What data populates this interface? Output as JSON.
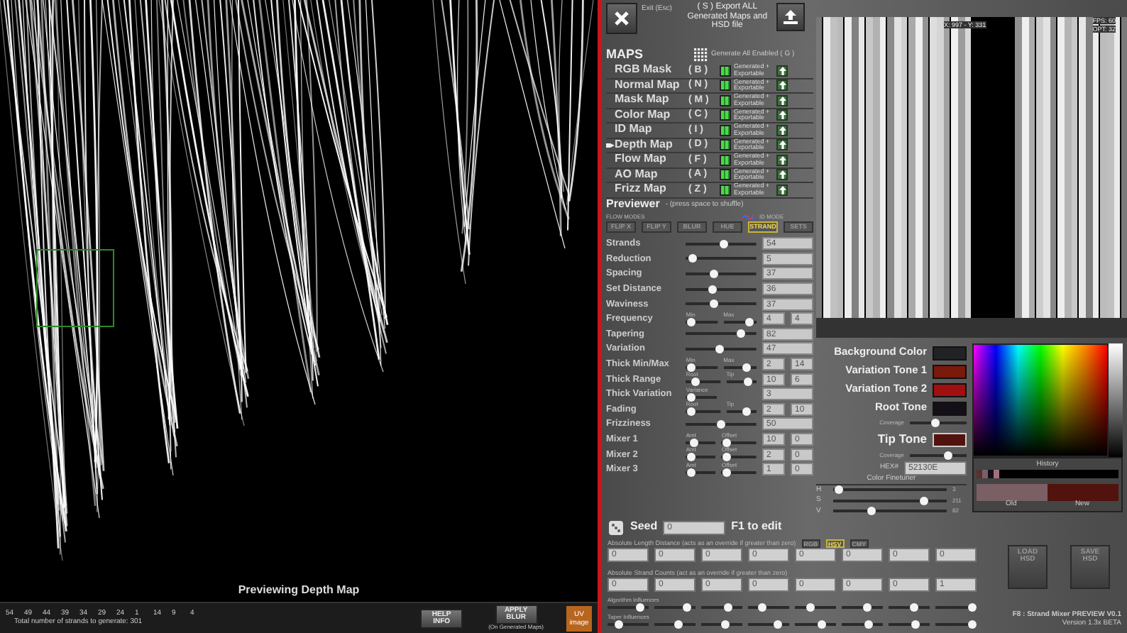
{
  "canvas": {
    "caption": "Previewing Depth Map"
  },
  "status_bar": {
    "counts": [
      "54",
      "49",
      "44",
      "39",
      "34",
      "29",
      "24",
      "1",
      "14",
      "9",
      "4"
    ],
    "total": "Total number of strands to generate: 301",
    "help_button": "HELP INFO",
    "blur_button": "APPLY BLUR",
    "blur_note": "(On Generated Maps)",
    "uv_button": "UV image"
  },
  "header": {
    "exit_label": "Exit (Esc)",
    "export_label": "( S ) Export ALL Generated Maps and HSD file"
  },
  "maps": {
    "title": "MAPS",
    "generate_all": "Generate All Enabled ( G )",
    "items": [
      {
        "name": "RGB Mask",
        "key": "( B )",
        "checked": true,
        "status": "Generated + Exportable",
        "previewing": false
      },
      {
        "name": "Normal Map",
        "key": "( N )",
        "checked": true,
        "status": "Generated + Exportable",
        "previewing": false
      },
      {
        "name": "Mask Map",
        "key": "( M )",
        "checked": true,
        "status": "Generated + Exportable",
        "previewing": false
      },
      {
        "name": "Color Map",
        "key": "( C )",
        "checked": true,
        "status": "Generated + Exportable",
        "previewing": false
      },
      {
        "name": "ID Map",
        "key": "( I )",
        "checked": true,
        "status": "Generated + Exportable",
        "previewing": false
      },
      {
        "name": "Depth Map",
        "key": "( D )",
        "checked": true,
        "status": "Generated + Exportable",
        "previewing": true
      },
      {
        "name": "Flow Map",
        "key": "( F )",
        "checked": true,
        "status": "Generated + Exportable",
        "previewing": false
      },
      {
        "name": "AO Map",
        "key": "( A )",
        "checked": true,
        "status": "Generated + Exportable",
        "previewing": false
      },
      {
        "name": "Frizz Map",
        "key": "( Z )",
        "checked": true,
        "status": "Generated + Exportable",
        "previewing": false
      }
    ]
  },
  "previewer": {
    "label": "Previewer",
    "hint": "- (press space to shuffle)",
    "flow_modes_label": "FLOW MODES",
    "id_mode_label": "ID MODE",
    "modes": [
      {
        "label": "FLIP X",
        "selected": false
      },
      {
        "label": "FLIP Y",
        "selected": false
      },
      {
        "label": "BLUR",
        "selected": false
      },
      {
        "label": "HUE",
        "selected": false
      },
      {
        "label": "STRAND",
        "selected": true
      },
      {
        "label": "SETS",
        "selected": false
      }
    ]
  },
  "sliders": [
    {
      "label": "Strands",
      "kind": "single",
      "level": 0.55,
      "value": "54"
    },
    {
      "label": "Reduction",
      "kind": "single",
      "level": 0.04,
      "value": "5"
    },
    {
      "label": "Spacing",
      "kind": "single",
      "level": 0.38,
      "value": "37"
    },
    {
      "label": "Set Distance",
      "kind": "single",
      "level": 0.36,
      "value": "36"
    },
    {
      "label": "Waviness",
      "kind": "single",
      "level": 0.38,
      "value": "37"
    },
    {
      "label": "Frequency",
      "kind": "dual",
      "parts": [
        {
          "caption": "Min",
          "level": 0.05,
          "value": "4"
        },
        {
          "caption": "Max",
          "level": 0.9,
          "value": "4"
        }
      ]
    },
    {
      "label": "Tapering",
      "kind": "single",
      "level": 0.82,
      "value": "82"
    },
    {
      "label": "Variation",
      "kind": "single",
      "level": 0.47,
      "value": "47"
    },
    {
      "label": "Thick Min/Max",
      "kind": "dual",
      "parts": [
        {
          "caption": "Min",
          "level": 0.05,
          "value": "2"
        },
        {
          "caption": "Max",
          "level": 0.75,
          "value": "14"
        }
      ]
    },
    {
      "label": "Thick Range",
      "kind": "dual",
      "parts": [
        {
          "caption": "Root",
          "level": 0.2,
          "value": "10"
        },
        {
          "caption": "Tip",
          "level": 0.8,
          "value": "6"
        }
      ]
    },
    {
      "label": "Thick Variation",
      "kind": "captioned",
      "caption": "Variance",
      "level": 0.03,
      "value": "3"
    },
    {
      "label": "Fading",
      "kind": "dual",
      "parts": [
        {
          "caption": "Root",
          "level": 0.05,
          "value": "2"
        },
        {
          "caption": "Tip",
          "level": 0.75,
          "value": "10"
        }
      ]
    },
    {
      "label": "Frizziness",
      "kind": "single",
      "level": 0.5,
      "value": "50"
    },
    {
      "label": "Mixer 1",
      "kind": "dual",
      "parts": [
        {
          "caption": "Amt",
          "level": 0.2,
          "value": "10"
        },
        {
          "caption": "Offset",
          "level": 0.05,
          "value": "0"
        }
      ]
    },
    {
      "label": "Mixer 2",
      "kind": "dual",
      "parts": [
        {
          "caption": "Amt",
          "level": 0.05,
          "value": "2"
        },
        {
          "caption": "Offset",
          "level": 0.05,
          "value": "0"
        }
      ]
    },
    {
      "label": "Mixer 3",
      "kind": "dual",
      "parts": [
        {
          "caption": "Amt",
          "level": 0.05,
          "value": "1"
        },
        {
          "caption": "Offset",
          "level": 0.05,
          "value": "0"
        }
      ]
    }
  ],
  "preview": {
    "coords": "X: 997 - Y: 331",
    "fps": "FPS: 60",
    "opt": "OPT: 32"
  },
  "colors": {
    "swatches": [
      {
        "label": "Background Color",
        "color": "#202226",
        "selected": false
      },
      {
        "label": "Variation Tone 1",
        "color": "#7a1a0a",
        "selected": false
      },
      {
        "label": "Variation Tone 2",
        "color": "#a01010",
        "selected": false
      },
      {
        "label": "Root Tone",
        "color": "#151018",
        "selected": false,
        "coverage": {
          "label": "Coverage",
          "level": 0.45
        }
      },
      {
        "label": "Tip Tone",
        "color": "#52130e",
        "selected": true,
        "coverage": {
          "label": "Coverage",
          "level": 0.7
        }
      }
    ],
    "hex": {
      "label": "HEX#",
      "value": "52130E"
    },
    "finetuner_label": "Color Finetuner",
    "hsv": [
      {
        "label": "H",
        "level": 0.02,
        "value": "3"
      },
      {
        "label": "S",
        "level": 0.83,
        "value": "211"
      },
      {
        "label": "V",
        "level": 0.32,
        "value": "82"
      }
    ],
    "modes": [
      {
        "label": "RGB",
        "selected": false
      },
      {
        "label": "HSV",
        "selected": true
      },
      {
        "label": "CMY",
        "selected": false
      }
    ]
  },
  "history": {
    "label": "History",
    "swatches": [
      {
        "color": "#5a3030"
      },
      {
        "color": "#7a6065"
      },
      {
        "color": "#151018"
      },
      {
        "color": "#a07080"
      }
    ],
    "old": {
      "label": "Old",
      "color": "#7a6065"
    },
    "new": {
      "label": "New",
      "color": "#52130e"
    }
  },
  "seed": {
    "label": "Seed",
    "value": "0",
    "hint": "F1 to edit"
  },
  "absolute_length": {
    "label": "Absolute Length Distance (acts as an override if greater than zero)",
    "values": [
      "0",
      "0",
      "0",
      "0",
      "0",
      "0",
      "0",
      "0"
    ]
  },
  "absolute_counts": {
    "label": "Absolute Strand Counts (act as an override if greater than zero)",
    "values": [
      "0",
      "0",
      "0",
      "0",
      "0",
      "0",
      "0",
      "1"
    ]
  },
  "algorithm_influences": {
    "label": "Algorithm Influences",
    "sliders": [
      {
        "level": 0.85
      },
      {
        "level": 0.85
      },
      {
        "level": 0.7
      },
      {
        "level": 0.3
      },
      {
        "level": 0.35
      },
      {
        "level": 0.65
      },
      {
        "level": 0.65
      },
      {
        "level": 1
      }
    ]
  },
  "taper_influences": {
    "label": "Taper Influences",
    "sliders": [
      {
        "level": 0.2
      },
      {
        "level": 0.6
      },
      {
        "level": 0.6
      },
      {
        "level": 0.8
      },
      {
        "level": 0.7
      },
      {
        "level": 0.7
      },
      {
        "level": 0.7
      },
      {
        "level": 1
      }
    ]
  },
  "load_button": "LOAD HSD",
  "save_button": "SAVE HSD",
  "app_title": "F8 : Strand Mixer PREVIEW V0.1",
  "version": "Version 1.3x BETA"
}
